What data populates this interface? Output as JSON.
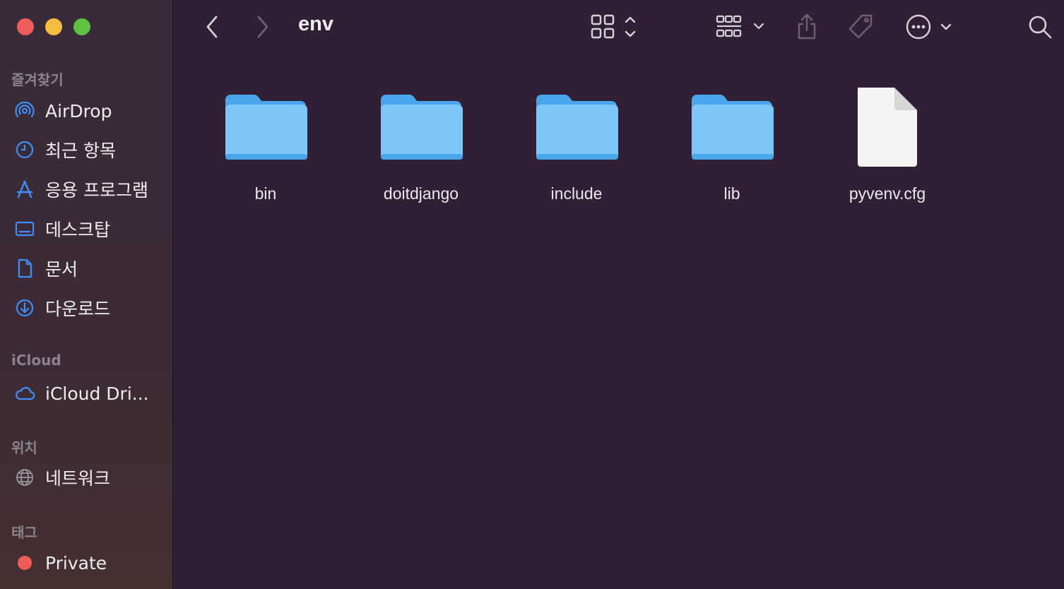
{
  "window": {
    "title": "env"
  },
  "sidebar": {
    "sections": {
      "favorites": "즐겨찾기",
      "icloud": "iCloud",
      "locations": "위치",
      "tags": "태그"
    },
    "items": [
      {
        "label": "AirDrop",
        "icon": "airdrop-icon"
      },
      {
        "label": "최근 항목",
        "icon": "clock-icon"
      },
      {
        "label": "응용 프로그램",
        "icon": "applications-icon"
      },
      {
        "label": "데스크탑",
        "icon": "desktop-icon"
      },
      {
        "label": "문서",
        "icon": "document-icon"
      },
      {
        "label": "다운로드",
        "icon": "download-icon"
      },
      {
        "label": "iCloud Dri...",
        "icon": "cloud-icon"
      },
      {
        "label": "네트워크",
        "icon": "globe-icon"
      },
      {
        "label": "Private",
        "icon": "tag-dot-icon",
        "color": "#ee5d59"
      }
    ]
  },
  "toolbar": {
    "icons": [
      "back-icon",
      "forward-icon",
      "grid-view-icon",
      "group-icon",
      "share-icon",
      "tag-icon",
      "more-icon",
      "search-icon"
    ]
  },
  "files": [
    {
      "name": "bin",
      "type": "folder"
    },
    {
      "name": "doitdjango",
      "type": "folder"
    },
    {
      "name": "include",
      "type": "folder"
    },
    {
      "name": "lib",
      "type": "folder"
    },
    {
      "name": "pyvenv.cfg",
      "type": "file"
    }
  ],
  "colors": {
    "background": "#312035",
    "accent": "#3d8ef7",
    "folder": "#7cc7f8"
  }
}
